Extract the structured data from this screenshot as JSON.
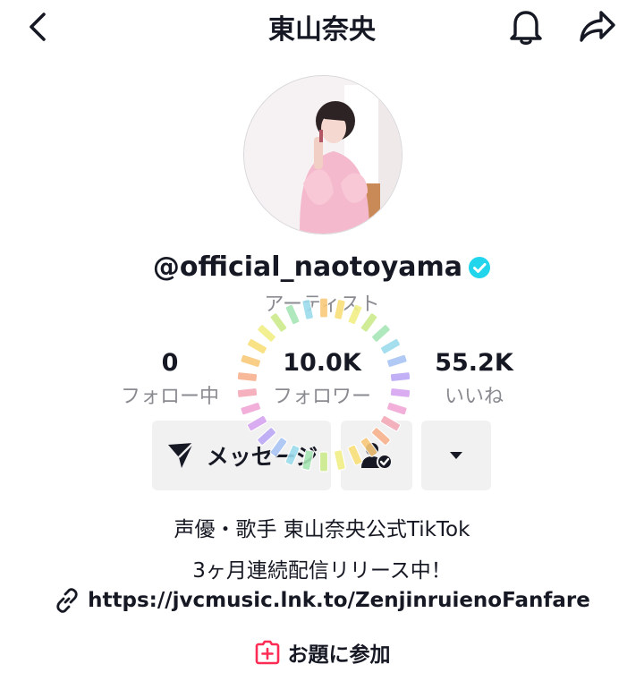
{
  "header": {
    "title": "東山奈央",
    "back_icon": "chevron-left-icon",
    "bell_icon": "bell-icon",
    "share_icon": "share-arrow-icon"
  },
  "profile": {
    "username": "@official_naotoyama",
    "verified_icon": "verified-badge-icon",
    "role": "アーティスト"
  },
  "stats": [
    {
      "value": "0",
      "label": "フォロー中"
    },
    {
      "value": "10.0K",
      "label": "フォロワー"
    },
    {
      "value": "55.2K",
      "label": "いいね"
    }
  ],
  "actions": {
    "message_label": "メッセージ",
    "message_icon": "send-icon",
    "following_icon": "user-check-icon",
    "more_icon": "caret-down-icon"
  },
  "bio": {
    "line1": "声優・歌手 東山奈央公式TikTok",
    "line2": "3ヶ月連続配信リリース中！",
    "link": "https://jvcmusic.lnk.to/ZenjinruienoFanfare",
    "link_icon": "link-icon"
  },
  "topic": {
    "label": "お題に参加",
    "icon": "add-topic-icon"
  },
  "colors": {
    "accent": "#fe2c55",
    "verified": "#20d5ec",
    "text": "#161823",
    "secondary": "#8a8b91"
  }
}
